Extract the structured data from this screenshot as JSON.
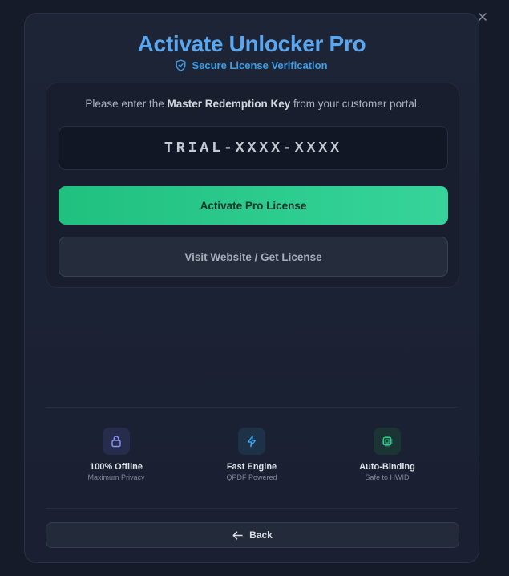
{
  "window": {
    "minimize_icon": "minimize-icon",
    "close_icon": "close-icon"
  },
  "header": {
    "title": "Activate Unlocker Pro",
    "subtitle": "Secure License Verification",
    "subtitle_icon": "shield-check-icon",
    "title_color": "#5aa7f0"
  },
  "form": {
    "instruction_prefix": "Please enter the ",
    "instruction_bold": "Master Redemption Key",
    "instruction_suffix": " from your customer portal.",
    "key_placeholder": "TRIAL-XXXX-XXXX",
    "key_value": "",
    "activate_label": "Activate Pro License",
    "visit_label": "Visit Website / Get License",
    "accent_color": "#2ccb8c"
  },
  "features": [
    {
      "icon": "lock-icon",
      "title": "100% Offline",
      "subtitle": "Maximum Privacy",
      "color": "#8b93f5"
    },
    {
      "icon": "lightning-icon",
      "title": "Fast Engine",
      "subtitle": "QPDF Powered",
      "color": "#3aa3ee"
    },
    {
      "icon": "cpu-chip-icon",
      "title": "Auto-Binding",
      "subtitle": "Safe to HWID",
      "color": "#2ccb8c"
    }
  ],
  "footer": {
    "back_label": "Back",
    "back_icon": "arrow-left-icon"
  }
}
